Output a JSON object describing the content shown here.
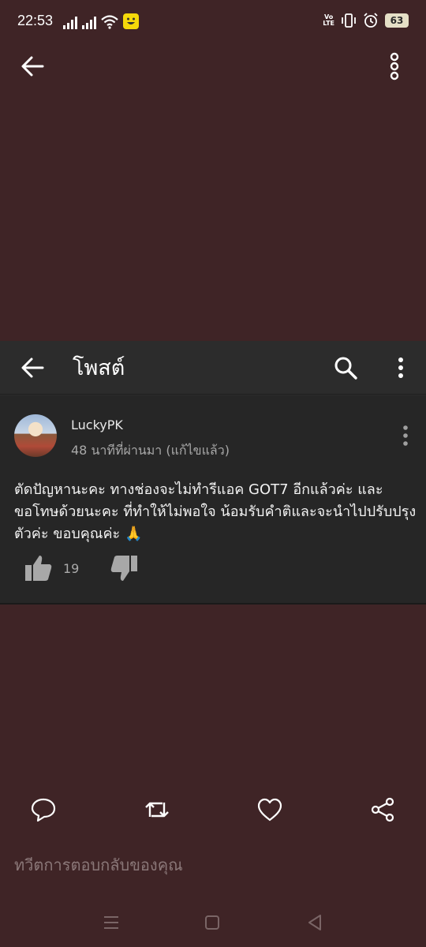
{
  "status_bar": {
    "time": "22:53",
    "volte_top": "Vo",
    "volte_bottom": "LTE",
    "battery": "63"
  },
  "post_panel": {
    "title": "โพสต์",
    "author": "LuckyPK",
    "meta": "48 นาทีที่ผ่านมา (แก้ไขแล้ว)",
    "text": "ตัดปัญหานะคะ ทางช่องจะไม่ทำรีแอค GOT7 อีกแล้วค่ะ และขอโทษด้วยนะคะ ที่ทำให้ไม่พอใจ น้อมรับคำติและจะนำไปปรับปรุงตัวค่ะ ขอบคุณค่ะ 🙏",
    "like_count": "19"
  },
  "reply": {
    "placeholder": "ทวีตการตอบกลับของคุณ"
  },
  "colors": {
    "background": "#3f2426",
    "panel": "#262626",
    "panel_header": "#2c2c2c"
  },
  "icons": {
    "outer_back": "arrow-left-icon",
    "outer_menu": "more-vertical-icon",
    "panel_back": "arrow-left-icon",
    "search": "search-icon",
    "panel_menu": "more-vertical-icon",
    "like": "thumbs-up-icon",
    "dislike": "thumbs-down-icon",
    "comment": "speech-bubble-icon",
    "retweet": "retweet-icon",
    "heart": "heart-icon",
    "share": "share-icon"
  }
}
